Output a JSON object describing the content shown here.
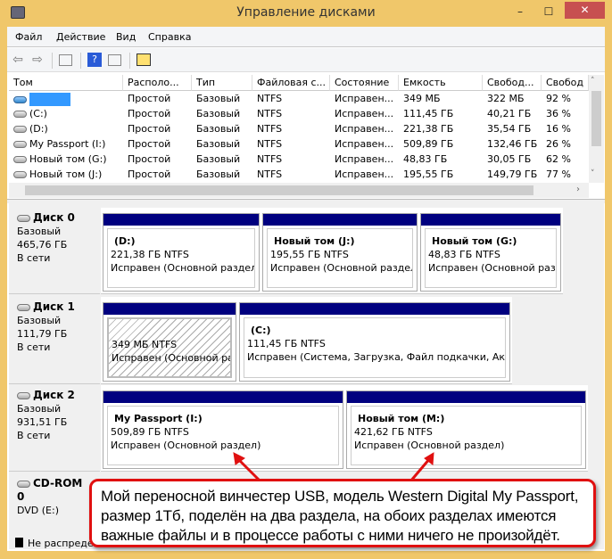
{
  "window": {
    "title": "Управление дисками",
    "minimize": "–",
    "maximize": "☐",
    "close": "✕"
  },
  "menu": [
    "Файл",
    "Действие",
    "Вид",
    "Справка"
  ],
  "toolbar": [
    "back-icon",
    "forward-icon",
    "console-tree-icon",
    "help-icon",
    "action-pane-icon",
    "properties-icon"
  ],
  "table": {
    "columns": [
      "Том",
      "Располо...",
      "Тип",
      "Файловая с...",
      "Состояние",
      "Емкость",
      "Свобод...",
      "Свобод"
    ],
    "rows": [
      {
        "name": "",
        "layout": "Простой",
        "type": "Базовый",
        "fs": "NTFS",
        "status": "Исправен...",
        "capacity": "349 МБ",
        "free": "322 МБ",
        "pct": "92 %",
        "highlight": true
      },
      {
        "name": "(C:)",
        "layout": "Простой",
        "type": "Базовый",
        "fs": "NTFS",
        "status": "Исправен...",
        "capacity": "111,45 ГБ",
        "free": "40,21 ГБ",
        "pct": "36 %"
      },
      {
        "name": "(D:)",
        "layout": "Простой",
        "type": "Базовый",
        "fs": "NTFS",
        "status": "Исправен...",
        "capacity": "221,38 ГБ",
        "free": "35,54 ГБ",
        "pct": "16 %"
      },
      {
        "name": "My Passport (I:)",
        "layout": "Простой",
        "type": "Базовый",
        "fs": "NTFS",
        "status": "Исправен...",
        "capacity": "509,89 ГБ",
        "free": "132,46 ГБ",
        "pct": "26 %"
      },
      {
        "name": "Новый том (G:)",
        "layout": "Простой",
        "type": "Базовый",
        "fs": "NTFS",
        "status": "Исправен...",
        "capacity": "48,83 ГБ",
        "free": "30,05 ГБ",
        "pct": "62 %"
      },
      {
        "name": "Новый том (J:)",
        "layout": "Простой",
        "type": "Базовый",
        "fs": "NTFS",
        "status": "Исправен...",
        "capacity": "195,55 ГБ",
        "free": "149,79 ГБ",
        "pct": "77 %"
      }
    ]
  },
  "disks": [
    {
      "name": "Диск 0",
      "type": "Базовый",
      "size": "465,76 ГБ",
      "state": "В сети",
      "partitions": [
        {
          "label": "(D:)",
          "size": "221,38 ГБ NTFS",
          "status": "Исправен (Основной раздел)"
        },
        {
          "label": "Новый том  (J:)",
          "size": "195,55 ГБ NTFS",
          "status": "Исправен (Основной раздел)"
        },
        {
          "label": "Новый том  (G:)",
          "size": "48,83 ГБ NTFS",
          "status": "Исправен (Основной раздел)"
        }
      ]
    },
    {
      "name": "Диск 1",
      "type": "Базовый",
      "size": "111,79 ГБ",
      "state": "В сети",
      "partitions": [
        {
          "label": "",
          "size": "349 МБ NTFS",
          "status": "Исправен (Основной раздел)",
          "selected": true
        },
        {
          "label": "(C:)",
          "size": "111,45 ГБ NTFS",
          "status": "Исправен (Система, Загрузка, Файл подкачки, Активный)"
        }
      ]
    },
    {
      "name": "Диск 2",
      "type": "Базовый",
      "size": "931,51 ГБ",
      "state": "В сети",
      "partitions": [
        {
          "label": "My Passport  (I:)",
          "size": "509,89 ГБ NTFS",
          "status": "Исправен (Основной раздел)"
        },
        {
          "label": "Новый том  (M:)",
          "size": "421,62 ГБ NTFS",
          "status": "Исправен (Основной раздел)"
        }
      ]
    }
  ],
  "cdrom": {
    "name": "CD-ROM 0",
    "drive": "DVD (E:)"
  },
  "legend": {
    "unallocated": "Не распреде"
  },
  "callout": "Мой переносной винчестер USB, модель Western Digital My Passport, размер 1Тб, поделён на два раздела, на обоих разделах имеются важные файлы и в процессе работы с ними ничего не произойдёт.",
  "colors": {
    "titlebar": "#f0c76a",
    "close": "#c75050",
    "partition_bar": "#00007f",
    "callout_border": "#e01010"
  }
}
